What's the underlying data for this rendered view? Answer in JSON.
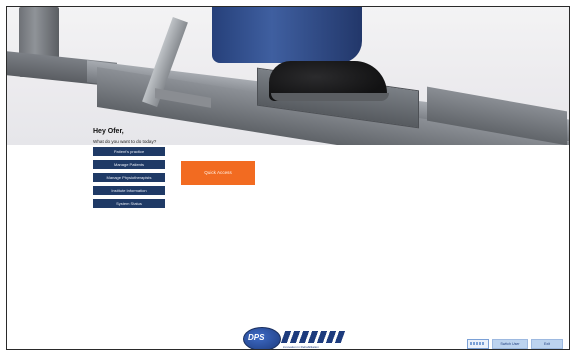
{
  "greeting": "Hey Ofer,",
  "question": "What do you want to do today?",
  "menu": [
    {
      "label": "Patient's practice"
    },
    {
      "label": "Manage Patients"
    },
    {
      "label": "Manage Physiotherapists"
    },
    {
      "label": "Institute Information"
    },
    {
      "label": "System Status"
    }
  ],
  "quick_access": {
    "label": "Quick Access"
  },
  "logo": {
    "mark": "DPS",
    "tagline": "innovation in Rehabilitation"
  },
  "footer": {
    "keyboard_icon": "keyboard-icon",
    "button1": "Switch User",
    "button2": "Exit"
  },
  "colors": {
    "menu_button": "#1f3a66",
    "quick_access": "#f26b21",
    "footer_button": "#bcd3ef"
  }
}
